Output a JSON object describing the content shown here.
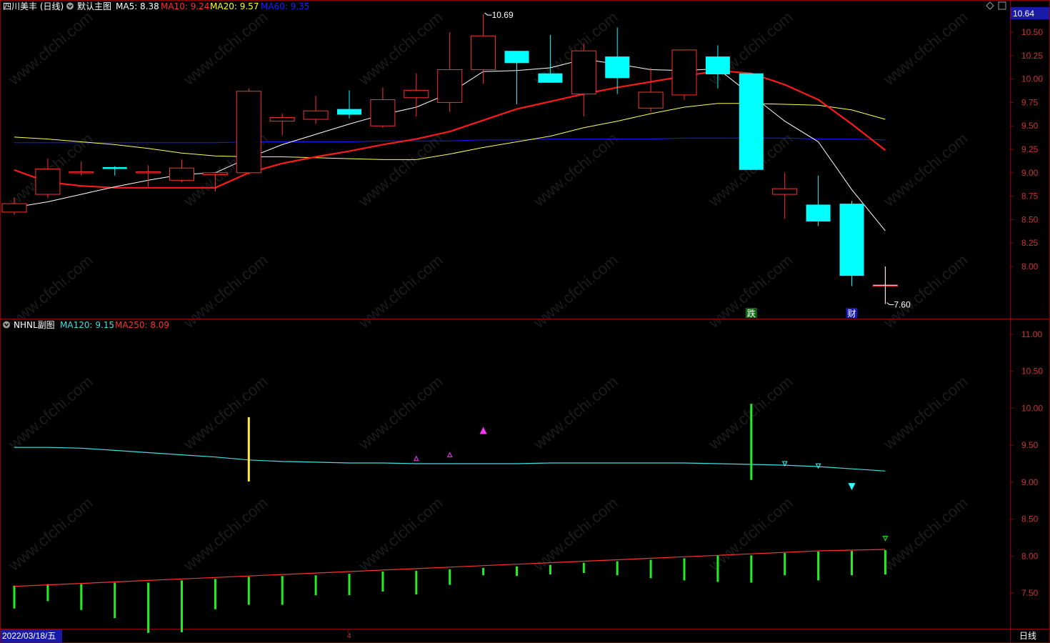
{
  "header": {
    "stock_name": "四川美丰 (日线)",
    "main_chart_name": "默认主图",
    "ma_labels": [
      {
        "label": "MA5: 8.38",
        "color": "#ffffff"
      },
      {
        "label": "MA10: 9.24",
        "color": "#ff3030"
      },
      {
        "label": "MA20: 9.57",
        "color": "#ffff00"
      },
      {
        "label": "MA60: 9.35",
        "color": "#2020ff"
      }
    ],
    "current_price_box": "10.64"
  },
  "sub_header": {
    "name": "NHNL副图",
    "ma_labels": [
      {
        "label": "MA120: 9.15",
        "color": "#40e0e0"
      },
      {
        "label": "MA250: 8.09",
        "color": "#ff3030"
      }
    ]
  },
  "footer": {
    "date_label": "2022/03/18/五",
    "month_marker": "4",
    "period_label": "日线"
  },
  "watermark": "www.cfchi.com",
  "colors": {
    "up": "#ff3030",
    "down": "#00ffff",
    "ma5": "#ffffff",
    "ma10": "#ff1a1a",
    "ma20": "#ffff55",
    "ma60": "#1a1aff",
    "grid": "#8b0000",
    "ma120": "#40e0e0",
    "ma250": "#ff3030",
    "bar_green": "#22ee22",
    "bar_yellow": "#ffee33",
    "tri_magenta": "#ff33ff",
    "tri_cyan": "#33ffff"
  },
  "chart_data": [
    {
      "type": "candlestick",
      "y_ticks": [
        "10.50",
        "10.25",
        "10.00",
        "9.75",
        "9.50",
        "9.25",
        "9.00",
        "8.75",
        "8.50",
        "8.25",
        "8.00"
      ],
      "ylim": [
        7.5,
        10.8
      ],
      "annotations": [
        {
          "text": "10.69",
          "at_index": 14,
          "value": 10.69
        },
        {
          "text": "7.60",
          "at_index": 26,
          "value": 7.6
        },
        {
          "text": "跌",
          "at_index": 22
        },
        {
          "text": "财",
          "at_index": 25
        }
      ],
      "candles": [
        {
          "o": 8.58,
          "h": 8.73,
          "l": 8.55,
          "c": 8.67
        },
        {
          "o": 8.77,
          "h": 9.15,
          "l": 8.73,
          "c": 9.04
        },
        {
          "o": 9.0,
          "h": 9.12,
          "l": 8.97,
          "c": 9.01
        },
        {
          "o": 9.06,
          "h": 9.07,
          "l": 8.97,
          "c": 9.04
        },
        {
          "o": 9.01,
          "h": 9.08,
          "l": 8.85,
          "c": 9.01
        },
        {
          "o": 8.92,
          "h": 9.14,
          "l": 8.9,
          "c": 9.05
        },
        {
          "o": 8.98,
          "h": 9.01,
          "l": 8.8,
          "c": 9.0
        },
        {
          "o": 9.0,
          "h": 9.9,
          "l": 8.98,
          "c": 9.87
        },
        {
          "o": 9.55,
          "h": 9.63,
          "l": 9.4,
          "c": 9.59
        },
        {
          "o": 9.57,
          "h": 9.82,
          "l": 9.52,
          "c": 9.66
        },
        {
          "o": 9.68,
          "h": 9.88,
          "l": 9.58,
          "c": 9.62
        },
        {
          "o": 9.5,
          "h": 9.91,
          "l": 9.48,
          "c": 9.78
        },
        {
          "o": 9.8,
          "h": 10.06,
          "l": 9.6,
          "c": 9.88
        },
        {
          "o": 9.75,
          "h": 10.5,
          "l": 9.65,
          "c": 10.1
        },
        {
          "o": 10.1,
          "h": 10.69,
          "l": 9.95,
          "c": 10.46
        },
        {
          "o": 10.3,
          "h": 10.3,
          "l": 9.73,
          "c": 10.17
        },
        {
          "o": 10.06,
          "h": 10.47,
          "l": 9.96,
          "c": 9.96
        },
        {
          "o": 9.84,
          "h": 10.38,
          "l": 9.6,
          "c": 10.3
        },
        {
          "o": 10.24,
          "h": 10.55,
          "l": 9.84,
          "c": 10.01
        },
        {
          "o": 9.69,
          "h": 10.12,
          "l": 9.65,
          "c": 9.86
        },
        {
          "o": 9.83,
          "h": 10.3,
          "l": 9.78,
          "c": 10.31
        },
        {
          "o": 10.24,
          "h": 10.36,
          "l": 9.9,
          "c": 10.05
        },
        {
          "o": 10.06,
          "h": 10.06,
          "l": 9.03,
          "c": 9.03
        },
        {
          "o": 8.77,
          "h": 9.0,
          "l": 8.51,
          "c": 8.83
        },
        {
          "o": 8.66,
          "h": 8.97,
          "l": 8.43,
          "c": 8.48
        },
        {
          "o": 8.67,
          "h": 8.7,
          "l": 7.79,
          "c": 7.9
        },
        {
          "o": 7.8,
          "h": 8.0,
          "l": 7.6,
          "c": 7.8
        }
      ],
      "ma5": [
        8.63,
        8.69,
        8.77,
        8.85,
        8.92,
        8.98,
        9.0,
        9.16,
        9.3,
        9.41,
        9.52,
        9.62,
        9.7,
        9.85,
        10.08,
        10.09,
        10.12,
        10.21,
        10.16,
        10.1,
        10.09,
        10.11,
        9.83,
        9.55,
        9.33,
        8.82,
        8.38
      ],
      "ma10": [
        9.03,
        8.9,
        8.86,
        8.84,
        8.84,
        8.84,
        8.84,
        9.0,
        9.1,
        9.17,
        9.23,
        9.3,
        9.36,
        9.44,
        9.56,
        9.68,
        9.76,
        9.84,
        9.91,
        9.97,
        10.03,
        10.09,
        10.06,
        9.94,
        9.78,
        9.52,
        9.24
      ],
      "ma20": [
        9.38,
        9.36,
        9.33,
        9.3,
        9.26,
        9.21,
        9.18,
        9.17,
        9.17,
        9.16,
        9.15,
        9.14,
        9.14,
        9.2,
        9.27,
        9.33,
        9.39,
        9.48,
        9.55,
        9.63,
        9.7,
        9.74,
        9.74,
        9.73,
        9.72,
        9.67,
        9.57
      ],
      "ma60": [
        9.32,
        9.32,
        9.32,
        9.32,
        9.32,
        9.32,
        9.32,
        9.33,
        9.33,
        9.33,
        9.33,
        9.34,
        9.34,
        9.34,
        9.35,
        9.35,
        9.36,
        9.36,
        9.36,
        9.36,
        9.37,
        9.37,
        9.37,
        9.37,
        9.36,
        9.36,
        9.35
      ]
    },
    {
      "type": "bar",
      "y_ticks": [
        "11.00",
        "10.50",
        "10.00",
        "9.50",
        "9.00",
        "8.50",
        "8.00",
        "7.50"
      ],
      "ylim": [
        7.0,
        11.2
      ],
      "ma120": [
        9.47,
        9.47,
        9.46,
        9.43,
        9.4,
        9.37,
        9.34,
        9.3,
        9.28,
        9.27,
        9.26,
        9.26,
        9.25,
        9.25,
        9.25,
        9.25,
        9.26,
        9.26,
        9.26,
        9.26,
        9.26,
        9.25,
        9.24,
        9.23,
        9.21,
        9.18,
        9.15
      ],
      "ma250": [
        7.59,
        7.61,
        7.63,
        7.65,
        7.67,
        7.69,
        7.71,
        7.73,
        7.75,
        7.77,
        7.79,
        7.81,
        7.83,
        7.85,
        7.87,
        7.89,
        7.91,
        7.93,
        7.95,
        7.97,
        7.99,
        8.01,
        8.03,
        8.05,
        8.07,
        8.08,
        8.09
      ],
      "green_bars": [
        {
          "top": 7.6,
          "bottom": 7.29
        },
        {
          "top": 7.62,
          "bottom": 7.39
        },
        {
          "top": 7.62,
          "bottom": 7.27
        },
        {
          "top": 7.64,
          "bottom": 7.16
        },
        {
          "top": 7.64,
          "bottom": 6.96
        },
        {
          "top": 7.67,
          "bottom": 6.97
        },
        {
          "top": 7.69,
          "bottom": 7.28
        },
        {
          "top": 7.72,
          "bottom": 7.34
        },
        {
          "top": 7.73,
          "bottom": 7.34
        },
        {
          "top": 7.74,
          "bottom": 7.47
        },
        {
          "top": 7.76,
          "bottom": 7.47
        },
        {
          "top": 7.79,
          "bottom": 7.52
        },
        {
          "top": 7.8,
          "bottom": 7.48
        },
        {
          "top": 7.82,
          "bottom": 7.61
        },
        {
          "top": 7.84,
          "bottom": 7.74
        },
        {
          "top": 7.86,
          "bottom": 7.73
        },
        {
          "top": 7.88,
          "bottom": 7.75
        },
        {
          "top": 7.91,
          "bottom": 7.77
        },
        {
          "top": 7.93,
          "bottom": 7.74
        },
        {
          "top": 7.95,
          "bottom": 7.7
        },
        {
          "top": 7.97,
          "bottom": 7.67
        },
        {
          "top": 8.01,
          "bottom": 7.65
        },
        {
          "top": 8.01,
          "bottom": 7.64
        },
        {
          "top": 8.04,
          "bottom": 7.74
        },
        {
          "top": 8.06,
          "bottom": 7.67
        },
        {
          "top": 8.07,
          "bottom": 7.74
        },
        {
          "top": 8.08,
          "bottom": 7.75
        }
      ],
      "special_bars": [
        {
          "index": 7,
          "top": 9.88,
          "bottom": 9.01,
          "color": "bar_yellow"
        },
        {
          "index": 22,
          "top": 10.06,
          "bottom": 9.03,
          "color": "bar_green"
        }
      ],
      "triangles": [
        {
          "index": 12,
          "value": 9.32,
          "dir": "up",
          "color": "tri_magenta",
          "size": "small"
        },
        {
          "index": 13,
          "value": 9.37,
          "dir": "up",
          "color": "tri_magenta",
          "size": "small"
        },
        {
          "index": 14,
          "value": 9.7,
          "dir": "up",
          "color": "tri_magenta",
          "size": "large"
        },
        {
          "index": 23,
          "value": 9.25,
          "dir": "down",
          "color": "tri_cyan",
          "size": "small"
        },
        {
          "index": 24,
          "value": 9.22,
          "dir": "down",
          "color": "tri_cyan",
          "size": "small"
        },
        {
          "index": 25,
          "value": 8.94,
          "dir": "down",
          "color": "tri_cyan",
          "size": "large"
        },
        {
          "index": 26,
          "value": 8.24,
          "dir": "down",
          "color": "bar_green",
          "size": "small"
        }
      ]
    }
  ]
}
